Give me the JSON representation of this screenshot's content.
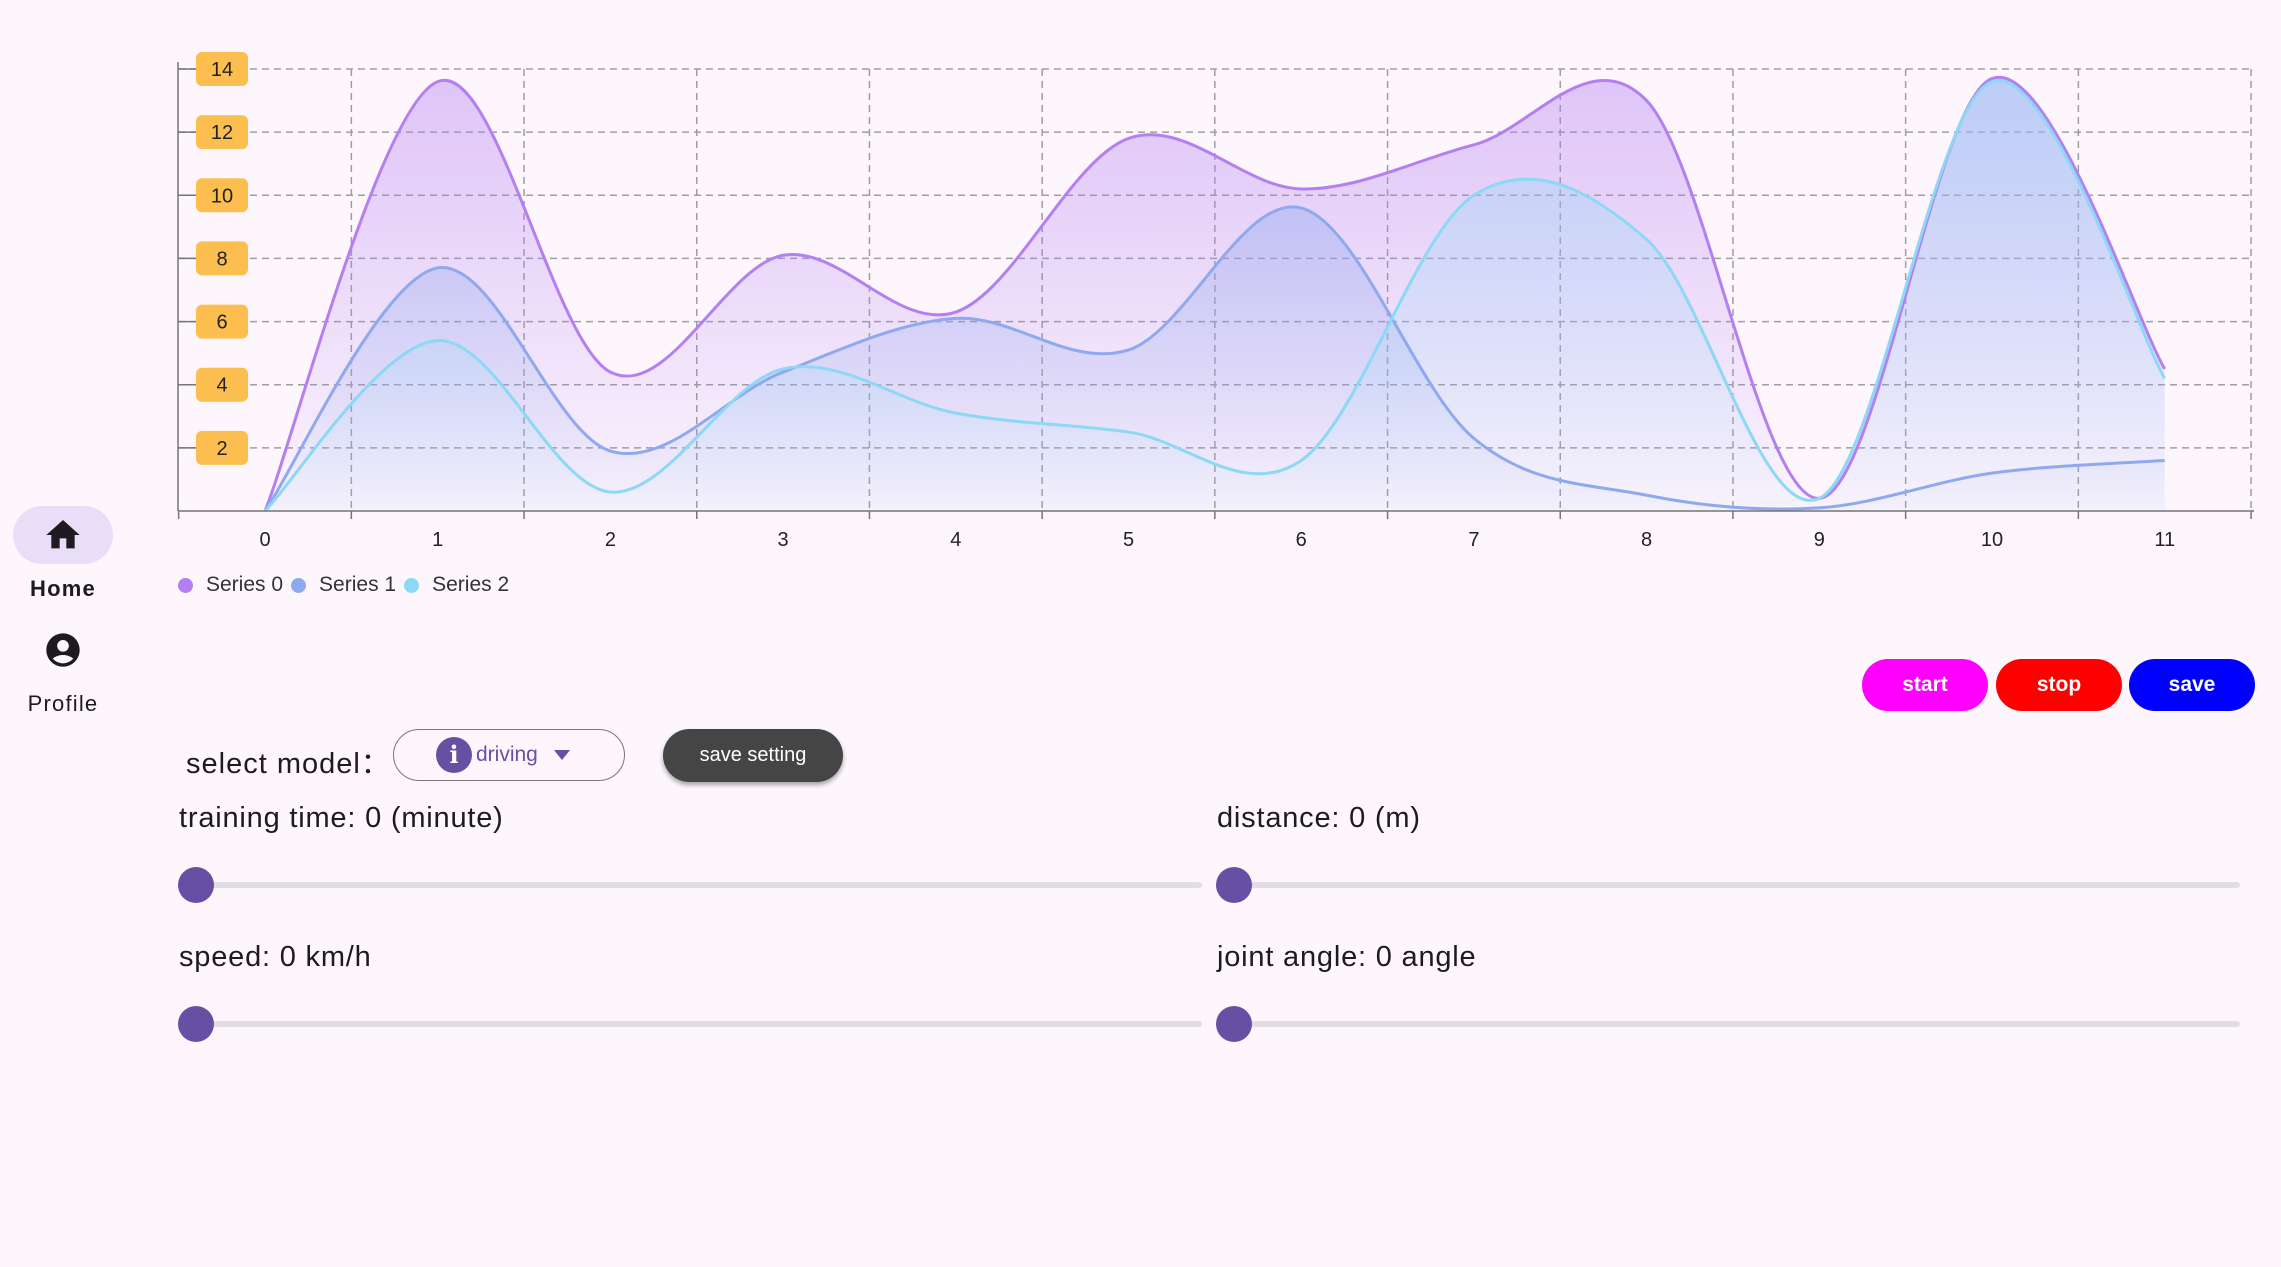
{
  "nav": {
    "items": [
      {
        "label": "Home",
        "icon": "home-icon",
        "active": true
      },
      {
        "label": "Profile",
        "icon": "account-circle-icon",
        "active": false
      }
    ]
  },
  "chart_data": {
    "type": "area",
    "x": [
      0,
      1,
      2,
      3,
      4,
      5,
      6,
      7,
      8,
      9,
      10,
      11
    ],
    "series": [
      {
        "name": "Series 0",
        "values": [
          0,
          13.6,
          4.4,
          8.1,
          6.3,
          11.8,
          10.2,
          11.6,
          13.0,
          0.4,
          13.7,
          4.5
        ],
        "color": "#b47ff0"
      },
      {
        "name": "Series 1",
        "values": [
          0,
          7.7,
          1.9,
          4.4,
          6.1,
          5.1,
          9.6,
          2.3,
          0.5,
          0.1,
          1.2,
          1.6
        ],
        "color": "#8fa9ee"
      },
      {
        "name": "Series 2",
        "values": [
          0,
          5.4,
          0.6,
          4.5,
          3.1,
          2.5,
          1.6,
          10.0,
          8.6,
          0.4,
          13.6,
          4.2
        ],
        "color": "#8cd8f5"
      }
    ],
    "yticks": [
      2,
      4,
      6,
      8,
      10,
      12,
      14
    ],
    "ylim": [
      0,
      14
    ],
    "xlim": [
      0,
      11
    ],
    "grid": true,
    "legend_position": "bottom-left",
    "tick_badge_color": "#fcbf4f"
  },
  "controls": {
    "start_label": "start",
    "stop_label": "stop",
    "save_label": "save",
    "start_color": "#ff00ff",
    "stop_color": "#ff0000",
    "save_color": "#0000ff"
  },
  "model": {
    "label": "select model：",
    "selected": "driving",
    "icon": "info-icon",
    "save_setting_label": "save setting"
  },
  "sliders": [
    {
      "label": "training time: 0 (minute)",
      "value": 0
    },
    {
      "label": "distance: 0 (m)",
      "value": 0
    },
    {
      "label": "speed: 0 km/h",
      "value": 0
    },
    {
      "label": "joint angle: 0 angle",
      "value": 0
    }
  ]
}
